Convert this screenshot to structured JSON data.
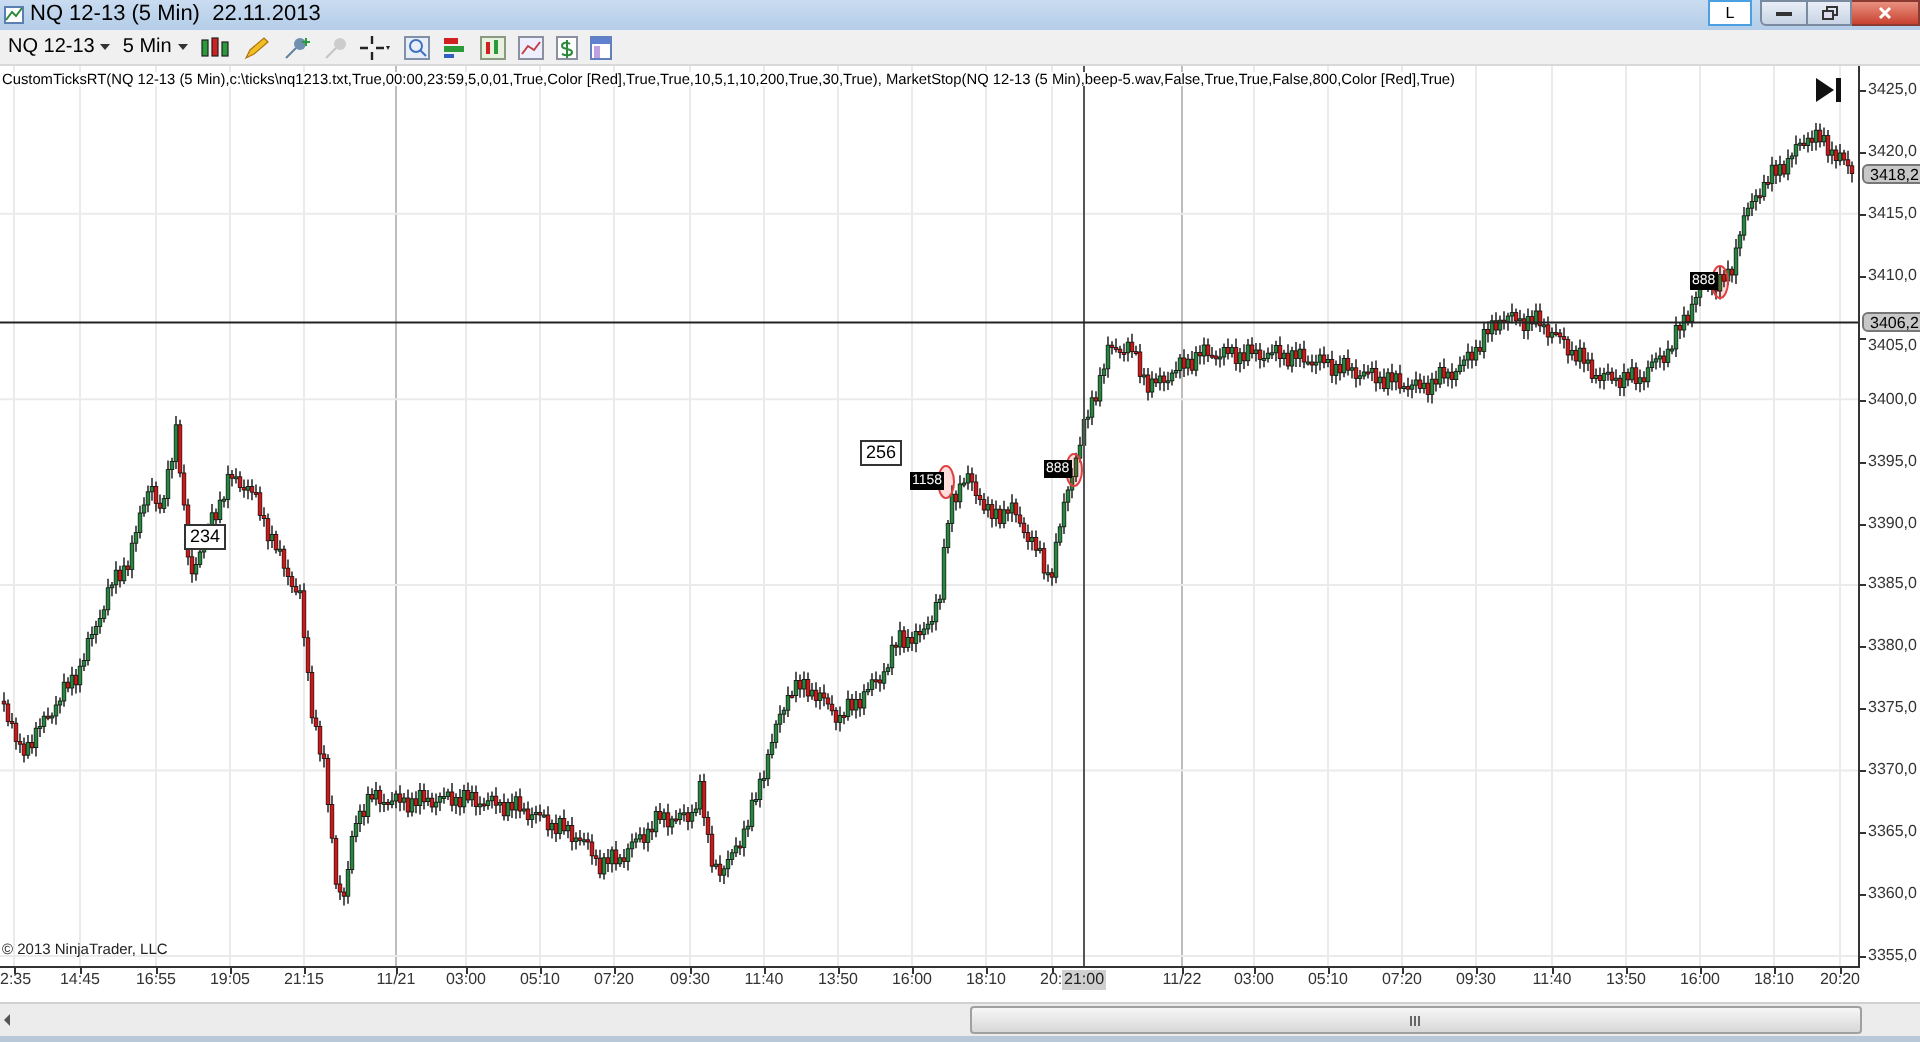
{
  "window": {
    "title": "NQ 12-13 (5 Min)  22.11.2013",
    "title_button": "L"
  },
  "toolbar": {
    "instrument": "NQ 12-13",
    "interval": "5 Min"
  },
  "chart": {
    "indicator_label": "CustomTicksRT(NQ 12-13 (5 Min),c:\\ticks\\nq1213.txt,True,00:00,23:59,5,0,01,True,Color [Red],True,True,10,5,1,10,200,True,30,True), MarketStop(NQ 12-13 (5 Min),beep-5.wav,False,True,True,False,800,Color [Red],True)",
    "copyright": "© 2013 NinjaTrader, LLC",
    "price_axis": [
      "3425,0",
      "3420,0",
      "3415,0",
      "3410,0",
      "3405,0",
      "3400,0",
      "3395,0",
      "3390,0",
      "3385,0",
      "3380,0",
      "3375,0",
      "3370,0",
      "3365,0",
      "3360,0",
      "3355,0"
    ],
    "last_price": "3418,2",
    "crosshair_price": "3406,2",
    "time_axis": [
      "2:35",
      "14:45",
      "16:55",
      "19:05",
      "21:15",
      "11/21",
      "03:00",
      "05:10",
      "07:20",
      "09:30",
      "11:40",
      "13:50",
      "16:00",
      "18:10",
      "20:",
      "11/22",
      "03:00",
      "05:10",
      "07:20",
      "09:30",
      "11:40",
      "13:50",
      "16:00",
      "18:10",
      "20:20"
    ],
    "crosshair_time": "21:00",
    "tags": [
      {
        "kind": "outline",
        "text": "234"
      },
      {
        "kind": "outline",
        "text": "256"
      },
      {
        "kind": "filled",
        "text": "1158"
      },
      {
        "kind": "filled",
        "text": "888"
      },
      {
        "kind": "filled",
        "text": "888"
      }
    ]
  }
}
